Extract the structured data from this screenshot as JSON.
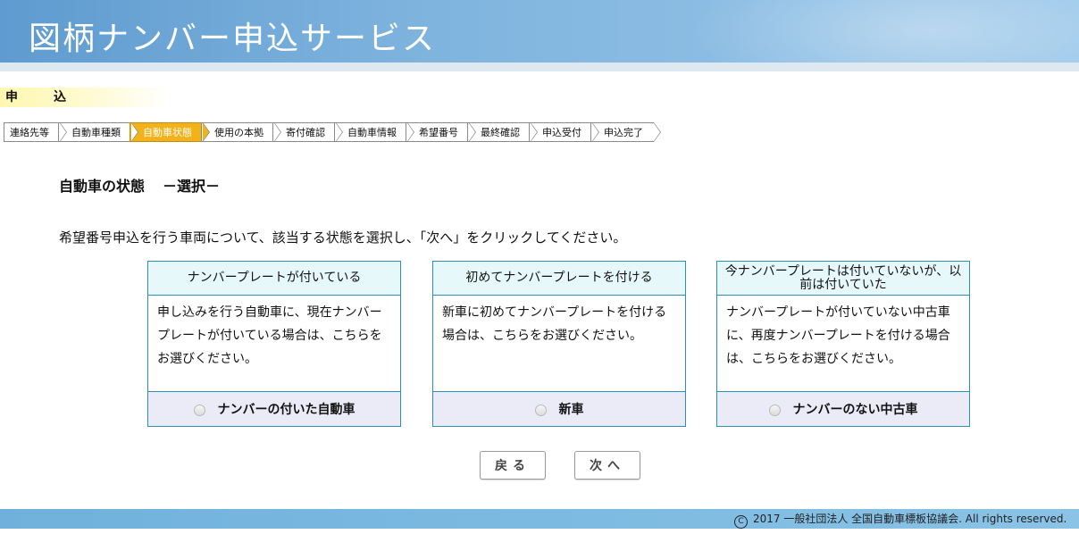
{
  "header": {
    "title": "図柄ナンバー申込サービス"
  },
  "section": {
    "label": "申込"
  },
  "steps": [
    {
      "label": "連絡先等",
      "active": false
    },
    {
      "label": "自動車種類",
      "active": false
    },
    {
      "label": "自動車状態",
      "active": true
    },
    {
      "label": "使用の本拠",
      "active": false
    },
    {
      "label": "寄付確認",
      "active": false
    },
    {
      "label": "自動車情報",
      "active": false
    },
    {
      "label": "希望番号",
      "active": false
    },
    {
      "label": "最終確認",
      "active": false
    },
    {
      "label": "申込受付",
      "active": false
    },
    {
      "label": "申込完了",
      "active": false
    }
  ],
  "page": {
    "title": "自動車の状態",
    "subtitle": "－選択－",
    "instruction": "希望番号申込を行う車両について、該当する状態を選択し、「次へ」をクリックしてください。"
  },
  "options": [
    {
      "heading": "ナンバープレートが付いている",
      "description": "申し込みを行う自動車に、現在ナンバープレートが付いている場合は、こちらをお選びください。",
      "choice": "ナンバーの付いた自動車"
    },
    {
      "heading": "初めてナンバープレートを付ける",
      "description": "新車に初めてナンバープレートを付ける場合は、こちらをお選びください。",
      "choice": "新車"
    },
    {
      "heading": "今ナンバープレートは付いていないが、以前は付いていた",
      "description": "ナンバープレートが付いていない中古車に、再度ナンバープレートを付ける場合は、こちらをお選びください。",
      "choice": "ナンバーのない中古車"
    }
  ],
  "buttons": {
    "back": "戻る",
    "next": "次へ"
  },
  "footer": {
    "copyright_symbol": "C",
    "text": "2017 一般社団法人 全国自動車標板協議会. All rights reserved."
  },
  "colors": {
    "active_step": "#f2b21a",
    "card_border": "#2f8fb0",
    "header": "#7fb4de"
  }
}
